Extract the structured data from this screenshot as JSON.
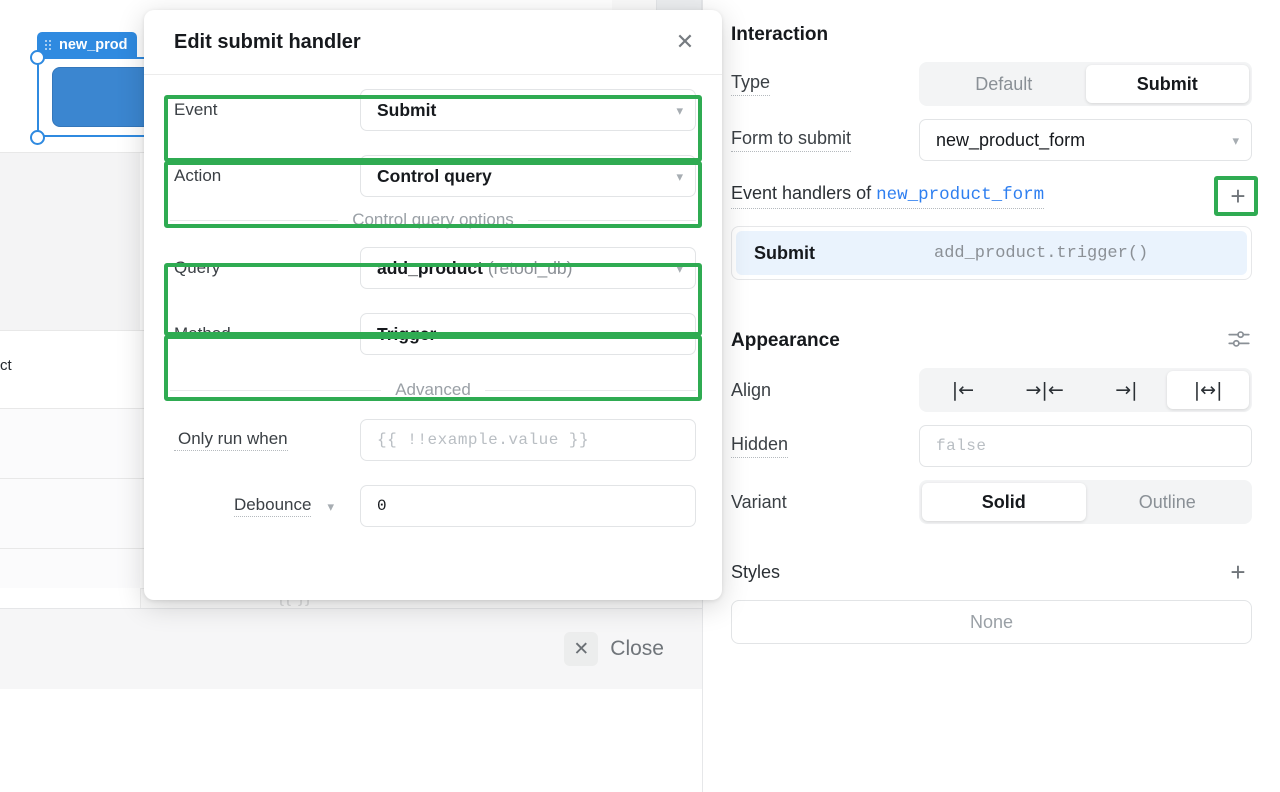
{
  "canvas": {
    "widget_label": "new_prod",
    "grip_icon": "drag-grip-icon",
    "text_fragment": "ct",
    "close_button": "Close",
    "close_icon": "close-x-icon"
  },
  "modal": {
    "title": "Edit submit handler",
    "close_icon": "close-x-icon",
    "rows": [
      {
        "label": "Event",
        "value": "Submit",
        "suffix": "",
        "chevron": "chevron-down-icon",
        "highlight": true
      },
      {
        "label": "Action",
        "value": "Control query",
        "suffix": "",
        "chevron": "chevron-down-icon",
        "highlight": true
      }
    ],
    "section_control_query": "Control query options",
    "control_rows": [
      {
        "label": "Query",
        "value": "add_product",
        "suffix": "(retool_db)",
        "chevron": "chevron-down-icon",
        "highlight": true
      },
      {
        "label": "Method",
        "value": "Trigger",
        "suffix": "",
        "chevron": "chevron-down-icon",
        "highlight": true
      }
    ],
    "section_advanced": "Advanced",
    "advanced": {
      "only_run_when_label": "Only run when",
      "only_run_when_placeholder": "{{ !!example.value }}",
      "only_run_when_value": "",
      "debounce_label": "Debounce",
      "debounce_chevron": "chevron-down-icon",
      "debounce_value": "0"
    }
  },
  "panel": {
    "interaction": {
      "title": "Interaction",
      "type_label": "Type",
      "type_options": [
        "Default",
        "Submit"
      ],
      "type_selected": "Submit",
      "form_label": "Form to submit",
      "form_value": "new_product_form",
      "form_chevron": "chevron-down-icon",
      "event_handlers_prefix": "Event handlers of ",
      "event_handlers_target": "new_product_form",
      "add_handler_icon": "plus-icon",
      "handlers": [
        {
          "event": "Submit",
          "code": "add_product.trigger()"
        }
      ]
    },
    "appearance": {
      "title": "Appearance",
      "settings_icon": "sliders-icon",
      "align_label": "Align",
      "align_options": [
        "align-left-icon",
        "align-center-icon",
        "align-right-icon",
        "align-stretch-icon"
      ],
      "align_glyphs": [
        "|←",
        "→|←",
        "→|",
        "|↔|"
      ],
      "align_selected": "align-stretch-icon",
      "hidden_label": "Hidden",
      "hidden_placeholder": "false",
      "hidden_value": "",
      "variant_label": "Variant",
      "variant_options": [
        "Solid",
        "Outline"
      ],
      "variant_selected": "Solid",
      "styles_label": "Styles",
      "styles_add_icon": "plus-icon",
      "styles_value": "None"
    }
  },
  "colors": {
    "highlight_green": "#2fab52",
    "accent_blue": "#2f8ae0",
    "link_blue": "#2f7ff0",
    "handler_row_bg": "#eaf3fd"
  }
}
